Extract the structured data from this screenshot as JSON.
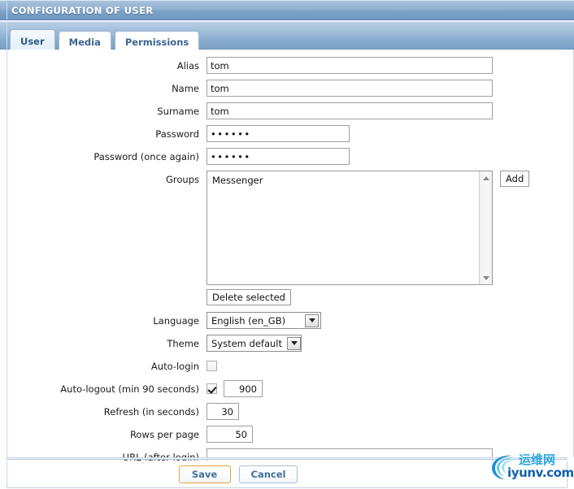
{
  "window": {
    "title": "CONFIGURATION OF USER"
  },
  "tabs": [
    {
      "label": "User",
      "active": true
    },
    {
      "label": "Media",
      "active": false
    },
    {
      "label": "Permissions",
      "active": false
    }
  ],
  "form": {
    "alias": {
      "label": "Alias",
      "value": "tom"
    },
    "name": {
      "label": "Name",
      "value": "tom"
    },
    "surname": {
      "label": "Surname",
      "value": "tom"
    },
    "password": {
      "label": "Password",
      "value": "••••••"
    },
    "password_again": {
      "label": "Password (once again)",
      "value": "••••••"
    },
    "groups": {
      "label": "Groups",
      "items": [
        "Messenger"
      ],
      "add_label": "Add",
      "delete_label": "Delete selected"
    },
    "language": {
      "label": "Language",
      "value": "English (en_GB)",
      "options": [
        "English (en_GB)"
      ]
    },
    "theme": {
      "label": "Theme",
      "value": "System default",
      "options": [
        "System default"
      ]
    },
    "auto_login": {
      "label": "Auto-login",
      "checked": false
    },
    "auto_logout": {
      "label": "Auto-logout (min 90 seconds)",
      "checked": true,
      "value": "900"
    },
    "refresh": {
      "label": "Refresh (in seconds)",
      "value": "30"
    },
    "rows_per_page": {
      "label": "Rows per page",
      "value": "50"
    },
    "url_after_login": {
      "label": "URL (after login)",
      "value": "",
      "placeholder": ""
    }
  },
  "footer": {
    "save_label": "Save",
    "cancel_label": "Cancel"
  },
  "watermark": {
    "cn_text": "运维网",
    "en_text": "iyunv.com"
  },
  "colors": {
    "titlebar_blue": "#7ea3c8",
    "tab_text": "#3a6591",
    "save_border": "#e8a33d",
    "cancel_border": "#a9c0d6",
    "watermark_cyan": "#2fa6dd",
    "watermark_blue": "#0f62a8"
  }
}
